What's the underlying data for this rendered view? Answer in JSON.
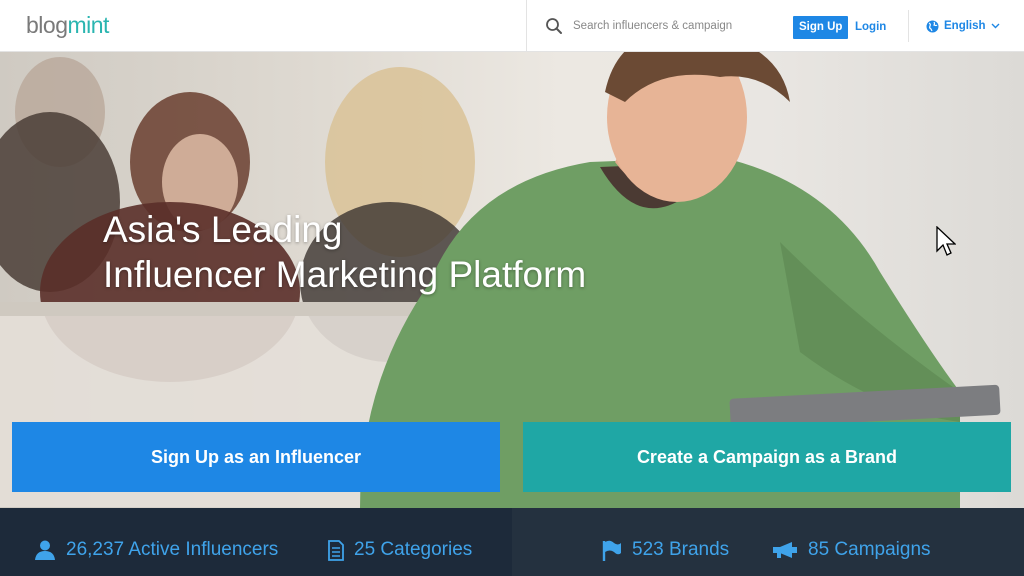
{
  "header": {
    "logo_part1": "blog",
    "logo_part2": "mint",
    "search_placeholder": "Search influencers & campaign",
    "signup_label": "Sign Up",
    "login_label": "Login",
    "language_label": "English"
  },
  "hero": {
    "title_line1": "Asia's Leading",
    "title_line2": "Influencer Marketing Platform",
    "cta_influencer": "Sign Up as an Influencer",
    "cta_brand": "Create a Campaign as a Brand"
  },
  "stats": {
    "influencers": "26,237 Active Influencers",
    "categories": "25 Categories",
    "brands": "523 Brands",
    "campaigns": "85 Campaigns"
  },
  "colors": {
    "primary_blue": "#1e87e5",
    "brand_teal": "#1fa7a5",
    "stats_bg": "#1d2a3a",
    "stats_text": "#3fa3ea"
  },
  "icons": {
    "search": "search-icon",
    "globe": "globe-icon",
    "chevron": "chevron-down-icon",
    "user": "user-icon",
    "document": "document-icon",
    "flag": "flag-icon",
    "megaphone": "megaphone-icon",
    "cursor": "mouse-cursor-icon"
  }
}
